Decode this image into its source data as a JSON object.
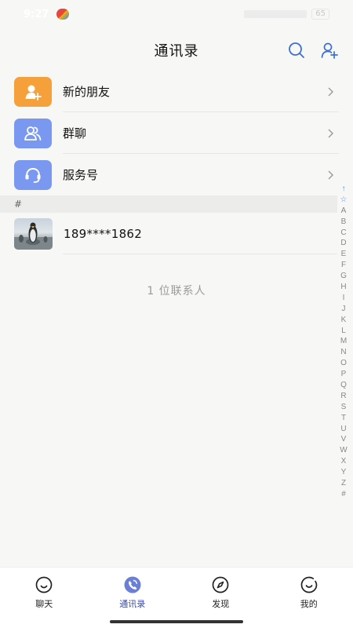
{
  "status_bar": {
    "time": "9:27",
    "battery": "65"
  },
  "header": {
    "title": "通讯录",
    "icons": [
      "search-icon",
      "add-contact-icon"
    ]
  },
  "menu": [
    {
      "label": "新的朋友",
      "icon": "add-friend-icon",
      "color": "#f6a03b"
    },
    {
      "label": "群聊",
      "icon": "group-icon",
      "color": "#7b98f0"
    },
    {
      "label": "服务号",
      "icon": "headset-icon",
      "color": "#7b98f0"
    }
  ],
  "section": {
    "header": "#"
  },
  "contacts": [
    {
      "name": "189****1862",
      "avatar": "penguin-avatar"
    }
  ],
  "contact_count": "1 位联系人",
  "alpha_index": [
    "↑",
    "☆",
    "A",
    "B",
    "C",
    "D",
    "E",
    "F",
    "G",
    "H",
    "I",
    "J",
    "K",
    "L",
    "M",
    "N",
    "O",
    "P",
    "Q",
    "R",
    "S",
    "T",
    "U",
    "V",
    "W",
    "X",
    "Y",
    "Z",
    "#"
  ],
  "tabs": [
    {
      "label": "聊天",
      "icon": "chat-icon",
      "active": false
    },
    {
      "label": "通讯录",
      "icon": "contacts-icon",
      "active": true
    },
    {
      "label": "发现",
      "icon": "compass-icon",
      "active": false
    },
    {
      "label": "我的",
      "icon": "profile-icon",
      "active": false
    }
  ],
  "colors": {
    "accent": "#3b4a9f",
    "index_accent": "#5b8def",
    "background": "#f7f8f6"
  }
}
